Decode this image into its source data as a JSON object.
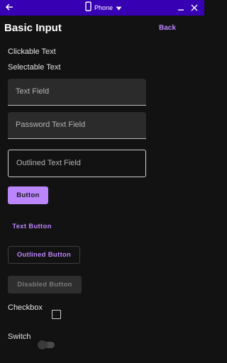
{
  "titlebar": {
    "device_label": "Phone",
    "back_icon": "arrow-left-icon",
    "device_icon": "phone-icon",
    "dropdown_icon": "caret-down-icon",
    "minimize_icon": "minimize-icon",
    "close_icon": "close-icon"
  },
  "page": {
    "title": "Basic Input",
    "back_label": "Back"
  },
  "texts": {
    "clickable": "Clickable Text",
    "selectable": "Selectable Text"
  },
  "fields": {
    "text_field_placeholder": "Text Field",
    "password_field_placeholder": "Password Text Field",
    "outlined_field_placeholder": "Outlined Text Field"
  },
  "buttons": {
    "contained": "Button",
    "text": "Text Button",
    "outlined": "Outlined Button",
    "disabled": "Disabled Button"
  },
  "controls": {
    "checkbox_label": "Checkbox",
    "checkbox_checked": false,
    "switch_label": "Switch",
    "switch_on": false
  },
  "colors": {
    "titlebar": "#3700b3",
    "accent": "#bb86fc",
    "background": "#121212"
  }
}
